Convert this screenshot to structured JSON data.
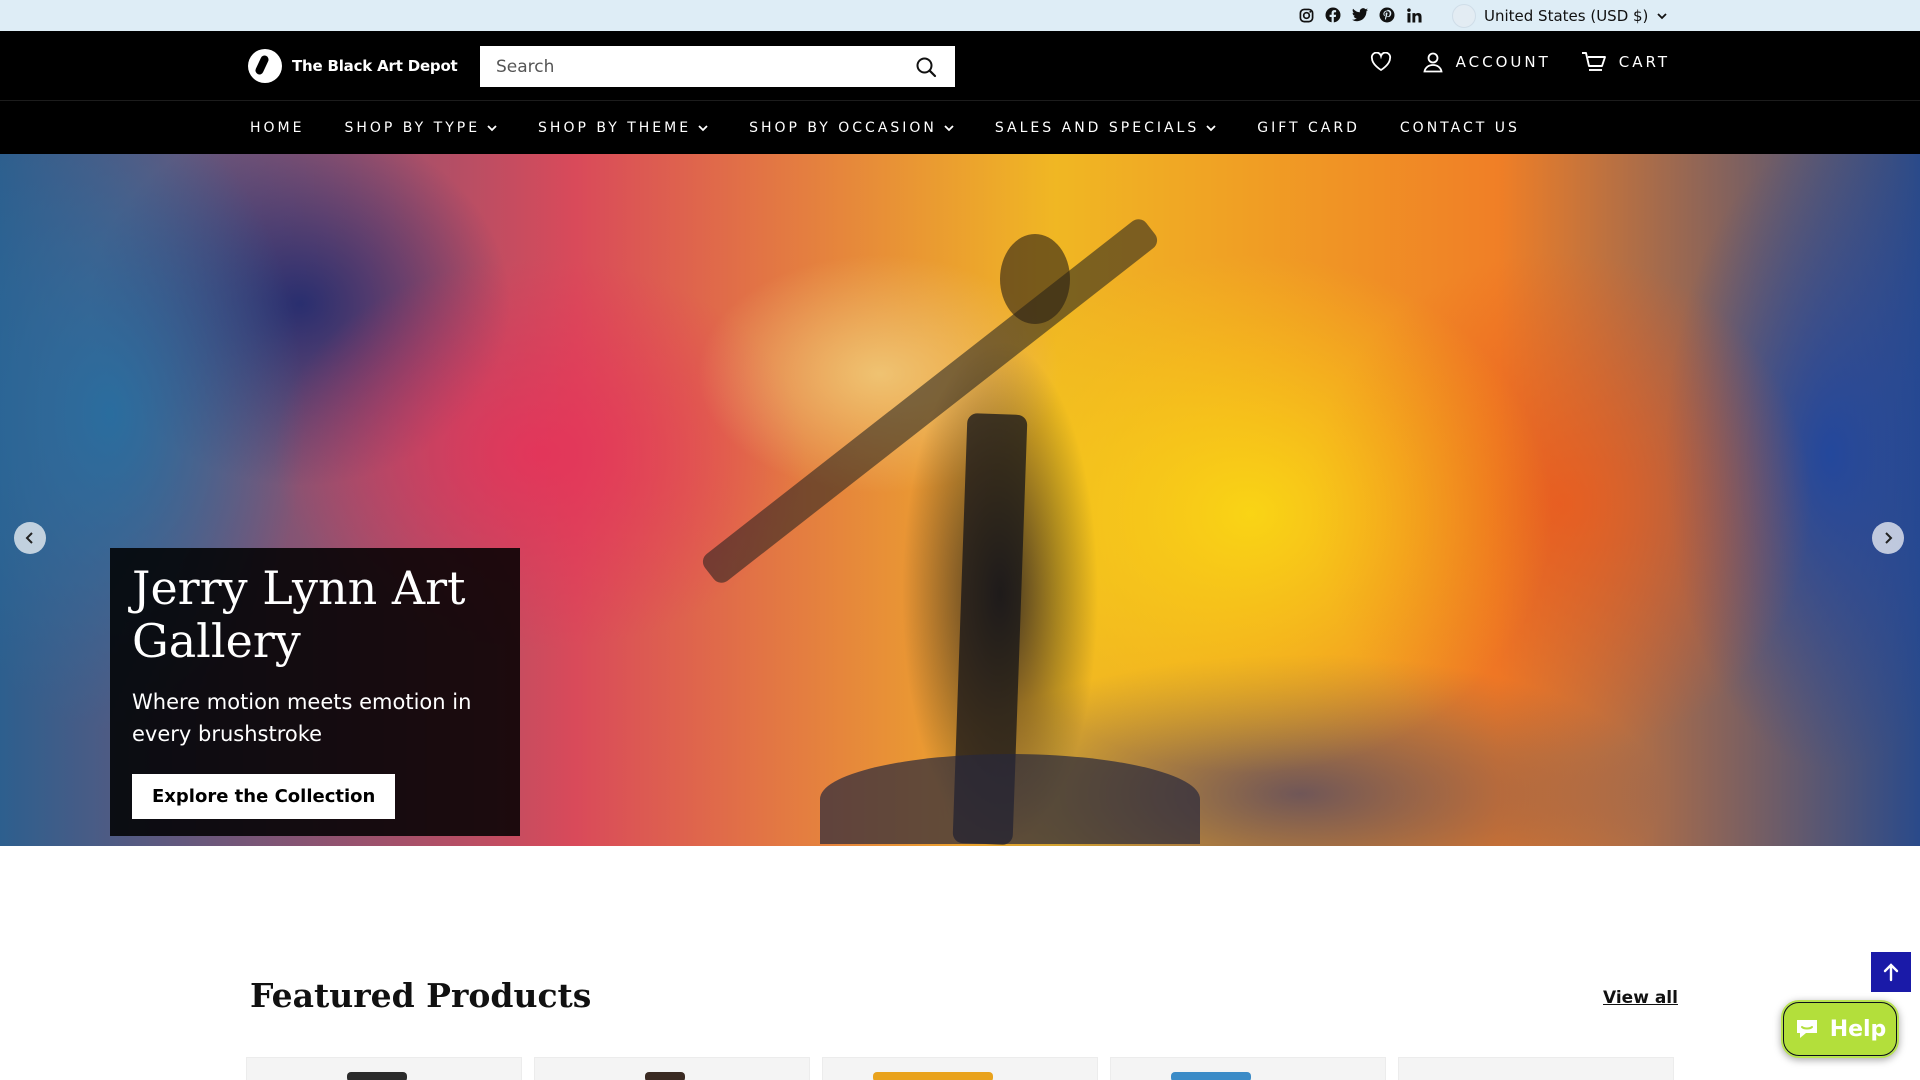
{
  "topbar": {
    "social_icons": [
      "instagram-icon",
      "facebook-icon",
      "twitter-icon",
      "pinterest-icon",
      "linkedin-icon"
    ],
    "currency_label": "United States (USD $)"
  },
  "header": {
    "logo_text": "The Black Art Depot",
    "search_placeholder": "Search",
    "account_label": "ACCOUNT",
    "cart_label": "CART",
    "icons": [
      "heart-icon",
      "user-icon",
      "cart-icon",
      "search-icon"
    ]
  },
  "nav": {
    "items": [
      {
        "label": "HOME",
        "has_dropdown": false
      },
      {
        "label": "SHOP BY TYPE",
        "has_dropdown": true
      },
      {
        "label": "SHOP BY THEME",
        "has_dropdown": true
      },
      {
        "label": "SHOP BY OCCASION",
        "has_dropdown": true
      },
      {
        "label": "SALES AND SPECIALS",
        "has_dropdown": true
      },
      {
        "label": "GIFT CARD",
        "has_dropdown": false
      },
      {
        "label": "CONTACT US",
        "has_dropdown": false
      }
    ]
  },
  "hero": {
    "title": "Jerry Lynn Art Gallery",
    "subtitle": "Where motion meets emotion in every brushstroke",
    "cta_label": "Explore the Collection"
  },
  "featured": {
    "title": "Featured Products",
    "view_all_label": "View all"
  },
  "widgets": {
    "help_label": "Help"
  },
  "colors": {
    "topbar_bg": "#deedf6",
    "header_bg": "#000000",
    "back_to_top_bg": "#1a1aa8",
    "help_bg": "#b3df3b"
  }
}
